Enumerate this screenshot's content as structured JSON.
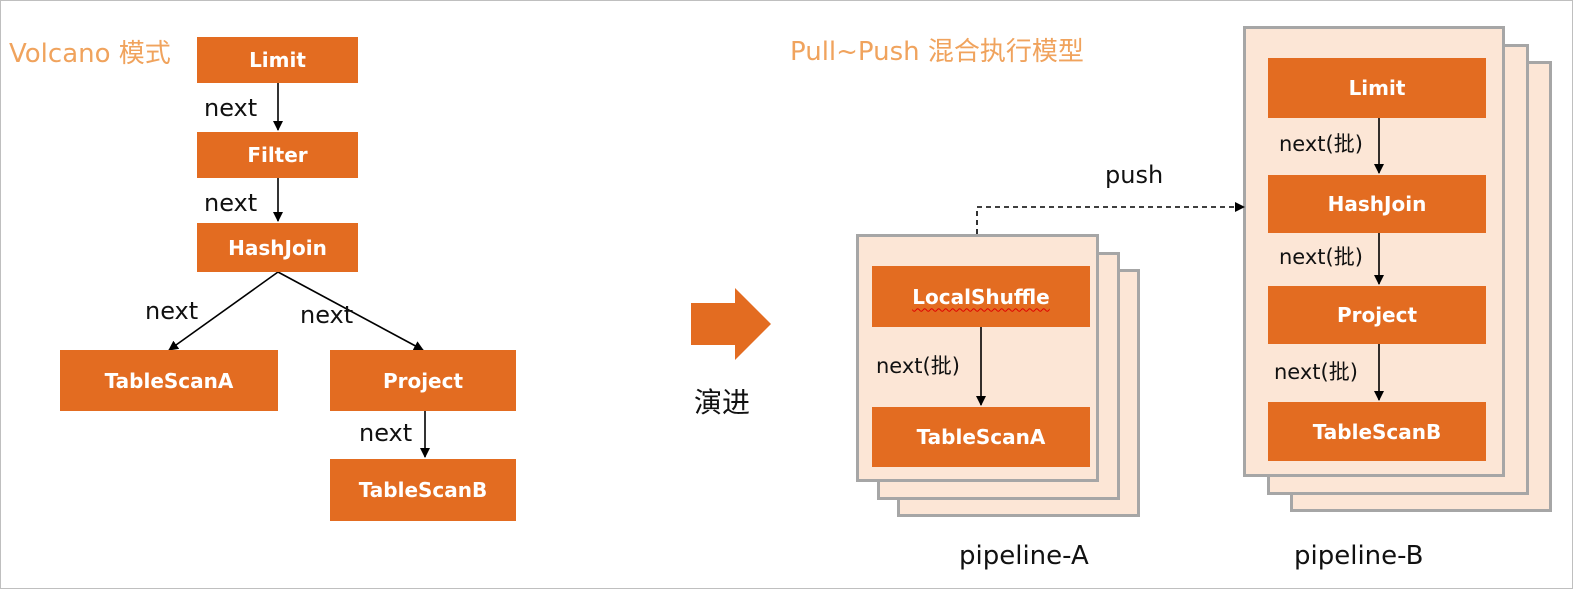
{
  "volcano": {
    "title": "Volcano 模式",
    "nodes": {
      "limit": "Limit",
      "filter": "Filter",
      "hashjoin": "HashJoin",
      "tablescan_a": "TableScanA",
      "project": "Project",
      "tablescan_b": "TableScanB"
    },
    "edge_label": "next"
  },
  "transition": {
    "label": "演进"
  },
  "pullpush": {
    "title": "Pull~Push 混合执行模型",
    "push_label": "push",
    "pipeline_a": {
      "name": "pipeline-A",
      "nodes": {
        "localshuffle": "LocalShuffle",
        "tablescan_a": "TableScanA"
      },
      "edge_label": "next(批)"
    },
    "pipeline_b": {
      "name": "pipeline-B",
      "nodes": {
        "limit": "Limit",
        "hashjoin": "HashJoin",
        "project": "Project",
        "tablescan_b": "TableScanB"
      },
      "edge_label": "next(批)"
    }
  },
  "colors": {
    "node_fill": "#e36c21",
    "title_text": "#f0a35d",
    "pipeline_fill": "#fce6d6",
    "pipeline_border": "#a6a6a6",
    "arrow_fill": "#e36c21"
  }
}
